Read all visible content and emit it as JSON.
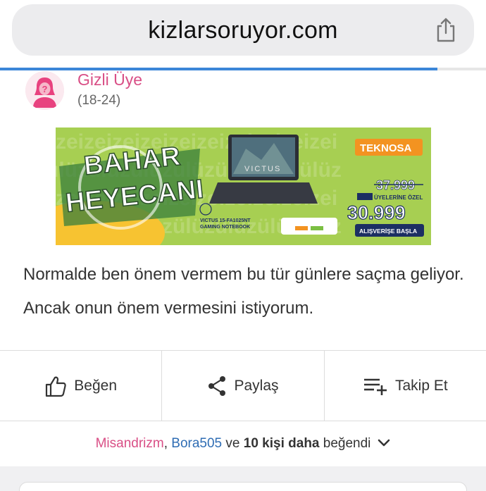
{
  "browser": {
    "url": "kizlarsoruyor.com",
    "share_icon": "share-icon",
    "load_progress_pct": 90
  },
  "author": {
    "name": "Gizli Üye",
    "age_range": "(18-24)",
    "avatar_icon": "anonymous-female-avatar-icon"
  },
  "ad": {
    "headline_line1": "BAHAR",
    "headline_line2": "HEYECANI",
    "brand": "TEKNOSA",
    "product_brand": "VICTUS",
    "product_name_line1": "VICTUS 15-FA1025NT",
    "product_name_line2": "GAMING NOTEBOOK",
    "old_price": "37.999",
    "member_label": "ÜYELERİNE ÖZEL",
    "new_price": "30.999",
    "cta": "ALIŞVERİŞE BAŞLA",
    "colors": {
      "bg": "#a7cf52",
      "orange": "#f39321",
      "navy": "#1c2f63"
    }
  },
  "post": {
    "text": "Normalde ben önem vermem bu tür günlere saçma geliyor. Ancak onun önem vermesini istiyorum."
  },
  "actions": {
    "like_label": "Beğen",
    "share_label": "Paylaş",
    "follow_label": "Takip Et"
  },
  "likes": {
    "user1": "Misandrizm",
    "comma": ",",
    "user2": "Bora505",
    "and": "ve",
    "count_text": "10 kişi daha",
    "suffix": "beğendi"
  },
  "colors": {
    "accent_pink": "#d94f86",
    "link_blue": "#2f6db4",
    "progress_blue": "#3b86d8"
  }
}
